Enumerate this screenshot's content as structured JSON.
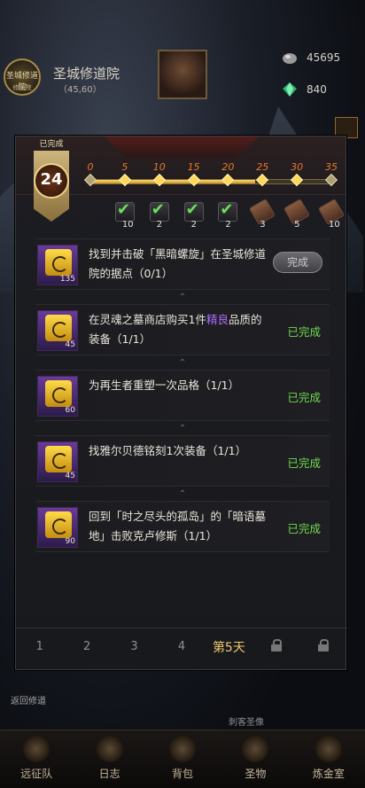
{
  "hud": {
    "location_title": "圣城修道院",
    "location_coords": "（45,60）",
    "badge_text": "圣城修道院",
    "badge_sub": "修道院",
    "resources": [
      {
        "icon": "silver-ore-icon",
        "value": "45695"
      },
      {
        "icon": "emerald-gem-icon",
        "value": "840"
      }
    ]
  },
  "panel": {
    "completed_tag": "已完成",
    "level": "24",
    "progress": {
      "ticks": [
        "0",
        "5",
        "10",
        "15",
        "20",
        "25",
        "30",
        "35"
      ],
      "current_points": 24,
      "max_points": 35
    },
    "rewards": [
      {
        "type": "done",
        "count": "10"
      },
      {
        "type": "done",
        "count": "2"
      },
      {
        "type": "done",
        "count": "2"
      },
      {
        "type": "done",
        "count": "2"
      },
      {
        "type": "locked",
        "count": "3"
      },
      {
        "type": "locked",
        "count": "5"
      },
      {
        "type": "locked",
        "count": "10"
      }
    ],
    "tasks": [
      {
        "text_parts": [
          "找到并击破「黑暗螺旋」在圣城修道院的据点（0/1）"
        ],
        "points": "135",
        "status": "完成",
        "state": "button"
      },
      {
        "text_parts": [
          "在灵魂之墓商店购买1件",
          "精良",
          "品质的装备（1/1）"
        ],
        "points": "45",
        "status": "已完成",
        "state": "done"
      },
      {
        "text_parts": [
          "为再生者重塑一次品格（1/1）"
        ],
        "points": "60",
        "status": "已完成",
        "state": "done"
      },
      {
        "text_parts": [
          "找雅尔贝德铭刻1次装备（1/1）"
        ],
        "points": "45",
        "status": "已完成",
        "state": "done"
      },
      {
        "text_parts": [
          "回到「时之尽头的孤岛」的「暗语墓地」击败克卢修斯（1/1）"
        ],
        "points": "90",
        "status": "已完成",
        "state": "done"
      }
    ],
    "day_tabs": [
      "1",
      "2",
      "3",
      "4",
      "第5天",
      "6",
      "7"
    ],
    "active_day_index": 4
  },
  "side_labels": [
    "返回修道",
    "刺客圣像"
  ],
  "bottom_nav": [
    {
      "icon": "horned-helmet-icon",
      "label": "远征队"
    },
    {
      "icon": "journal-icon",
      "label": "日志"
    },
    {
      "icon": "backpack-icon",
      "label": "背包"
    },
    {
      "icon": "relic-icon",
      "label": "圣物"
    },
    {
      "icon": "alchemy-icon",
      "label": "炼金室"
    }
  ],
  "colors": {
    "accent_gold": "#f0c96c",
    "done_green": "#6fda4e",
    "tick_orange": "#e77b2c",
    "highlight_purple": "#b06cff"
  }
}
